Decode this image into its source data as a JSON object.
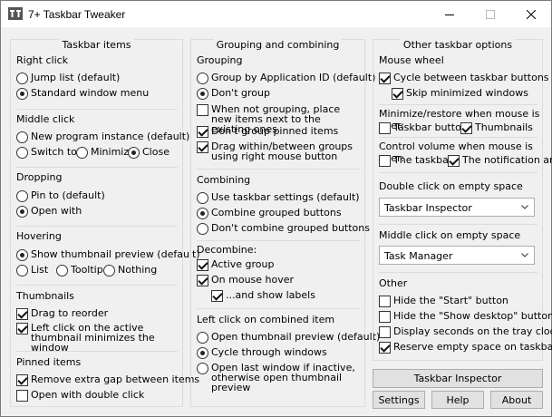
{
  "window": {
    "title": "7+ Taskbar Tweaker"
  },
  "taskbar_items": {
    "title": "Taskbar items",
    "right_click": {
      "heading": "Right click",
      "options": [
        "Jump list (default)",
        "Standard window menu"
      ]
    },
    "middle_click": {
      "heading": "Middle click",
      "options": [
        "New program instance (default)",
        "Switch to",
        "Minimize",
        "Close"
      ]
    },
    "dropping": {
      "heading": "Dropping",
      "options": [
        "Pin to (default)",
        "Open with"
      ]
    },
    "hovering": {
      "heading": "Hovering",
      "options": [
        "Show thumbnail preview (default)",
        "List",
        "Tooltip",
        "Nothing"
      ]
    },
    "thumbnails": {
      "heading": "Thumbnails",
      "options": [
        "Drag to reorder",
        "Left click on the active thumbnail minimizes the window"
      ]
    },
    "pinned_items": {
      "heading": "Pinned items",
      "options": [
        "Remove extra gap between items",
        "Open with double click"
      ]
    }
  },
  "grouping_combining": {
    "title": "Grouping and combining",
    "grouping": {
      "heading": "Grouping",
      "options": [
        "Group by Application ID (default)",
        "Don't group",
        "When not grouping, place new items next to the existing ones",
        "Don't group pinned items",
        "Drag within/between groups using right mouse button"
      ]
    },
    "combining": {
      "heading": "Combining",
      "options": [
        "Use taskbar settings (default)",
        "Combine grouped buttons",
        "Don't combine grouped buttons"
      ]
    },
    "decombine": {
      "heading": "Decombine:",
      "options": [
        "Active group",
        "On mouse hover",
        "...and show labels"
      ]
    },
    "left_click_combined": {
      "heading": "Left click on combined item",
      "options": [
        "Open thumbnail preview (default)",
        "Cycle through windows",
        "Open last window if inactive, otherwise open thumbnail preview"
      ]
    }
  },
  "other_options": {
    "title": "Other taskbar options",
    "mouse_wheel": {
      "heading": "Mouse wheel",
      "options": [
        "Cycle between taskbar buttons",
        "Skip minimized windows"
      ]
    },
    "minimize_restore": {
      "heading": "Minimize/restore when mouse is over:",
      "options": [
        "Taskbar buttons",
        "Thumbnails"
      ]
    },
    "control_volume": {
      "heading": "Control volume when mouse is over:",
      "options": [
        "The taskbar",
        "The notification area"
      ]
    },
    "double_click": {
      "heading": "Double click on empty space",
      "selected": "Taskbar Inspector"
    },
    "middle_click_empty": {
      "heading": "Middle click on empty space",
      "selected": "Task Manager"
    },
    "other": {
      "heading": "Other",
      "options": [
        "Hide the \"Start\" button",
        "Hide the \"Show desktop\" button",
        "Display seconds on the tray clock",
        "Reserve empty space on taskbar"
      ]
    }
  },
  "buttons": {
    "taskbar_inspector": "Taskbar Inspector",
    "settings": "Settings",
    "help": "Help",
    "about": "About"
  }
}
